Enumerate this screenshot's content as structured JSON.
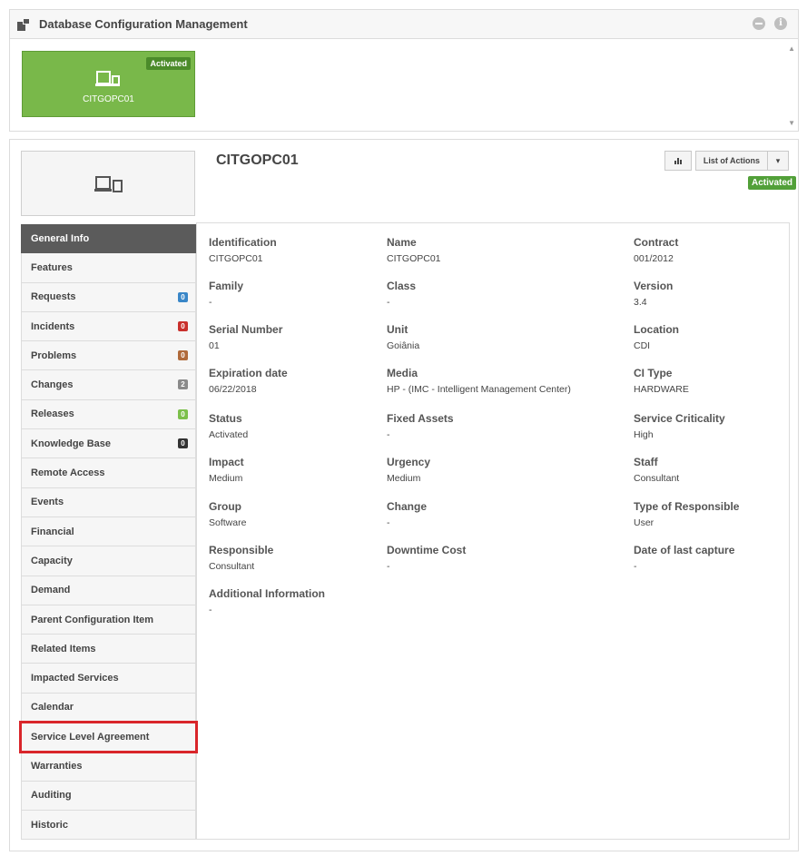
{
  "header": {
    "title": "Database Configuration Management",
    "icon": "database-icon"
  },
  "tile": {
    "badge": "Activated",
    "name": "CITGOPC01",
    "icon": "devices-icon",
    "color": "#79b84a"
  },
  "item": {
    "title": "CITGOPC01",
    "status": "Activated",
    "list_actions_label": "List of Actions",
    "chart_icon": "bar-chart-icon",
    "caret_icon": "caret-down-icon"
  },
  "nav": {
    "items": [
      {
        "label": "General Info"
      },
      {
        "label": "Features"
      },
      {
        "label": "Requests",
        "badge": "0",
        "badge_color": "#3a87c8"
      },
      {
        "label": "Incidents",
        "badge": "0",
        "badge_color": "#c9302c"
      },
      {
        "label": "Problems",
        "badge": "0",
        "badge_color": "#b06a3b"
      },
      {
        "label": "Changes",
        "badge": "2",
        "badge_color": "#8a8a8a"
      },
      {
        "label": "Releases",
        "badge": "0",
        "badge_color": "#7cc04b"
      },
      {
        "label": "Knowledge Base",
        "badge": "0",
        "badge_color": "#333333"
      },
      {
        "label": "Remote Access"
      },
      {
        "label": "Events"
      },
      {
        "label": "Financial"
      },
      {
        "label": "Capacity"
      },
      {
        "label": "Demand"
      },
      {
        "label": "Parent Configuration Item"
      },
      {
        "label": "Related Items"
      },
      {
        "label": "Impacted Services"
      },
      {
        "label": "Calendar"
      },
      {
        "label": "Service Level Agreement"
      },
      {
        "label": "Warranties"
      },
      {
        "label": "Auditing"
      },
      {
        "label": "Historic"
      }
    ]
  },
  "fields": {
    "identification": {
      "label": "Identification",
      "value": "CITGOPC01"
    },
    "name": {
      "label": "Name",
      "value": "CITGOPC01"
    },
    "contract": {
      "label": "Contract",
      "value": "001/2012"
    },
    "family": {
      "label": "Family",
      "value": "-"
    },
    "class": {
      "label": "Class",
      "value": "-"
    },
    "version": {
      "label": "Version",
      "value": "3.4"
    },
    "serial": {
      "label": "Serial Number",
      "value": "01"
    },
    "unit": {
      "label": "Unit",
      "value": "Goiânia"
    },
    "location": {
      "label": "Location",
      "value": "CDI"
    },
    "expiration": {
      "label": "Expiration date",
      "value": "06/22/2018"
    },
    "media": {
      "label": "Media",
      "value": "HP - (IMC - Intelligent Management Center)"
    },
    "ci_type": {
      "label": "CI Type",
      "value": "HARDWARE"
    },
    "status": {
      "label": "Status",
      "value": "Activated"
    },
    "fixed_assets": {
      "label": "Fixed Assets",
      "value": "-"
    },
    "criticality": {
      "label": "Service Criticality",
      "value": "High"
    },
    "impact": {
      "label": "Impact",
      "value": "Medium"
    },
    "urgency": {
      "label": "Urgency",
      "value": "Medium"
    },
    "staff": {
      "label": "Staff",
      "value": "Consultant"
    },
    "group": {
      "label": "Group",
      "value": "Software"
    },
    "change": {
      "label": "Change",
      "value": "-"
    },
    "responsible_type": {
      "label": "Type of Responsible",
      "value": "User"
    },
    "responsible": {
      "label": "Responsible",
      "value": "Consultant"
    },
    "downtime": {
      "label": "Downtime Cost",
      "value": "-"
    },
    "last_capture": {
      "label": "Date of last capture",
      "value": "-"
    },
    "additional": {
      "label": "Additional Information",
      "value": "-"
    }
  }
}
